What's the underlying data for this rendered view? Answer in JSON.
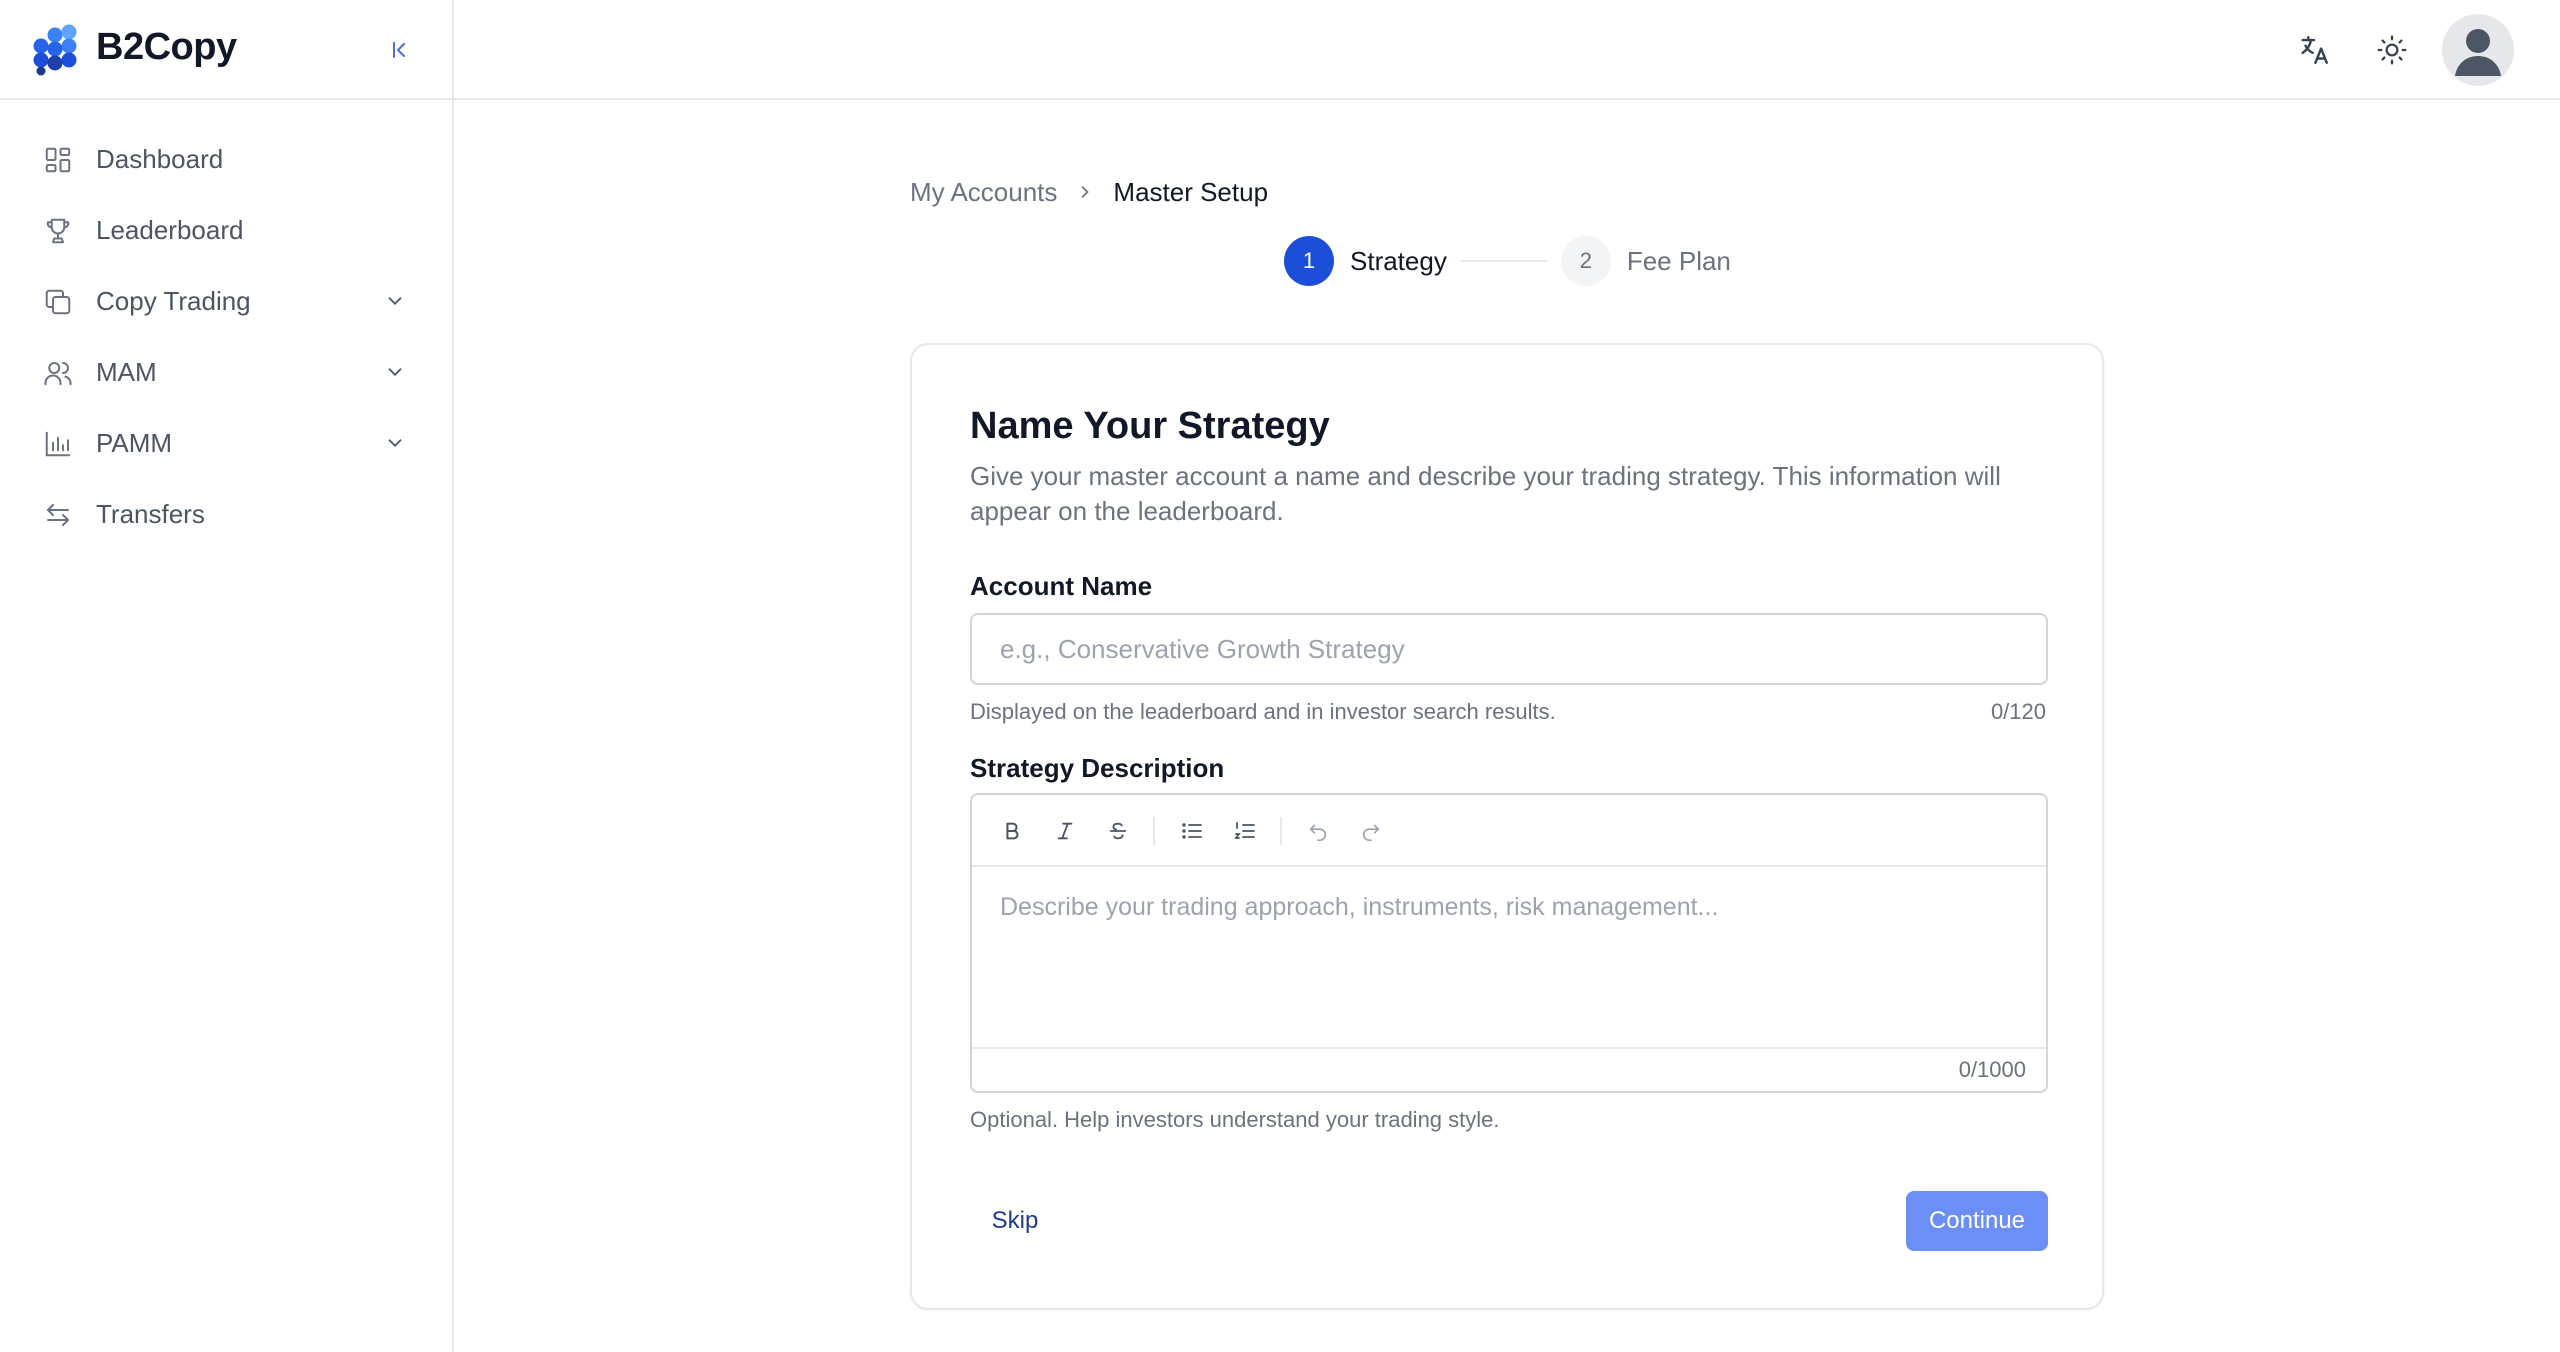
{
  "app": {
    "name": "B2Copy"
  },
  "sidebar": {
    "items": [
      {
        "label": "Dashboard",
        "icon": "dashboard-icon",
        "expandable": false
      },
      {
        "label": "Leaderboard",
        "icon": "trophy-icon",
        "expandable": false
      },
      {
        "label": "Copy Trading",
        "icon": "copy-icon",
        "expandable": true
      },
      {
        "label": "MAM",
        "icon": "users-icon",
        "expandable": true
      },
      {
        "label": "PAMM",
        "icon": "bar-chart-icon",
        "expandable": true
      },
      {
        "label": "Transfers",
        "icon": "transfer-arrows-icon",
        "expandable": false
      }
    ]
  },
  "breadcrumb": {
    "parent": "My Accounts",
    "current": "Master Setup"
  },
  "stepper": {
    "steps": [
      {
        "number": "1",
        "label": "Strategy",
        "state": "active"
      },
      {
        "number": "2",
        "label": "Fee Plan",
        "state": "inactive"
      }
    ]
  },
  "form": {
    "title": "Name Your Strategy",
    "description": "Give your master account a name and describe your trading strategy. This information will appear on the leaderboard.",
    "account_name": {
      "label": "Account Name",
      "value": "",
      "placeholder": "e.g., Conservative Growth Strategy",
      "hint": "Displayed on the leaderboard and in investor search results.",
      "counter": "0/120"
    },
    "strategy_description": {
      "label": "Strategy Description",
      "placeholder": "Describe your trading approach, instruments, risk management...",
      "counter": "0/1000",
      "hint": "Optional. Help investors understand your trading style."
    },
    "skip_label": "Skip",
    "continue_label": "Continue"
  },
  "colors": {
    "accent": "#1d4ed8",
    "continue_disabled": "#6b8ff7",
    "skip_text": "#1e3a8a"
  }
}
